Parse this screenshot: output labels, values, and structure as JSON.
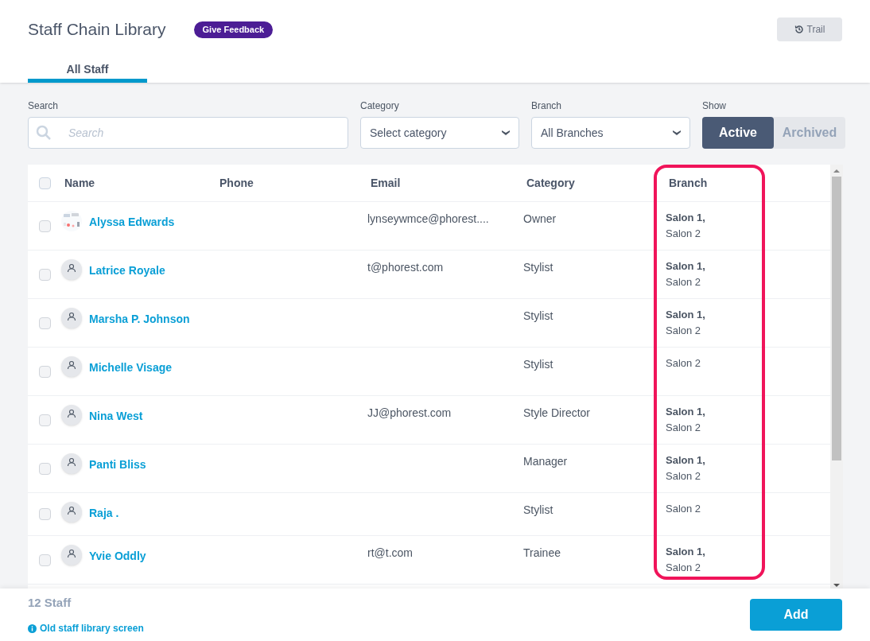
{
  "header": {
    "title": "Staff Chain Library",
    "feedback_button": "Give Feedback",
    "trail_button": "Trail"
  },
  "tabs": [
    {
      "label": "All Staff",
      "selected": true
    }
  ],
  "filters": {
    "search": {
      "label": "Search",
      "placeholder": "Search"
    },
    "category": {
      "label": "Category",
      "value": "Select category"
    },
    "branch": {
      "label": "Branch",
      "value": "All Branches"
    },
    "show": {
      "label": "Show",
      "options": [
        {
          "label": "Active",
          "selected": true
        },
        {
          "label": "Archived",
          "selected": false
        }
      ]
    }
  },
  "table": {
    "select_all_checked": false,
    "columns": [
      {
        "label": "Name"
      },
      {
        "label": "Phone"
      },
      {
        "label": "Email"
      },
      {
        "label": "Category"
      },
      {
        "label": "Branch"
      }
    ],
    "rows": [
      {
        "checked": false,
        "name": "Alyssa Edwards",
        "email": "lynseywmce@phorest....",
        "category": "Owner",
        "branch": [
          {
            "text": "Salon 1,",
            "bold": true
          },
          {
            "text": "Salon 2",
            "bold": false
          }
        ]
      },
      {
        "checked": false,
        "kind": "person",
        "name": "Latrice Royale",
        "email": "t@phorest.com",
        "category": "Stylist",
        "branch": [
          {
            "text": "Salon 1,",
            "bold": true
          },
          {
            "text": "Salon 2",
            "bold": false
          }
        ]
      },
      {
        "checked": false,
        "kind": "person",
        "name": "Marsha P. Johnson",
        "category": "Stylist",
        "branch": [
          {
            "text": "Salon 1,",
            "bold": true
          },
          {
            "text": "Salon 2",
            "bold": false
          }
        ]
      },
      {
        "checked": false,
        "kind": "person",
        "name": "Michelle Visage",
        "category": "Stylist",
        "branch": [
          {
            "text": "Salon 2",
            "bold": false
          }
        ]
      },
      {
        "checked": false,
        "kind": "person",
        "name": "Nina West",
        "email": "JJ@phorest.com",
        "category": "Style Director",
        "branch": [
          {
            "text": "Salon 1,",
            "bold": true
          },
          {
            "text": "Salon 2",
            "bold": false
          }
        ]
      },
      {
        "checked": false,
        "kind": "person",
        "name": "Panti Bliss",
        "category": "Manager",
        "branch": [
          {
            "text": "Salon 1,",
            "bold": true
          },
          {
            "text": "Salon 2",
            "bold": false
          }
        ]
      },
      {
        "checked": false,
        "kind": "person",
        "name": "Raja .",
        "category": "Stylist",
        "branch": [
          {
            "text": "Salon 2",
            "bold": false
          }
        ]
      },
      {
        "checked": false,
        "kind": "person",
        "name": "Yvie Oddly",
        "email": "rt@t.com",
        "category": "Trainee",
        "branch": [
          {
            "text": "Salon 1,",
            "bold": true
          },
          {
            "text": "Salon 2",
            "bold": false
          }
        ]
      }
    ]
  },
  "footer": {
    "count": "12 Staff",
    "old_link": "Old staff library screen",
    "add_button": "Add"
  }
}
